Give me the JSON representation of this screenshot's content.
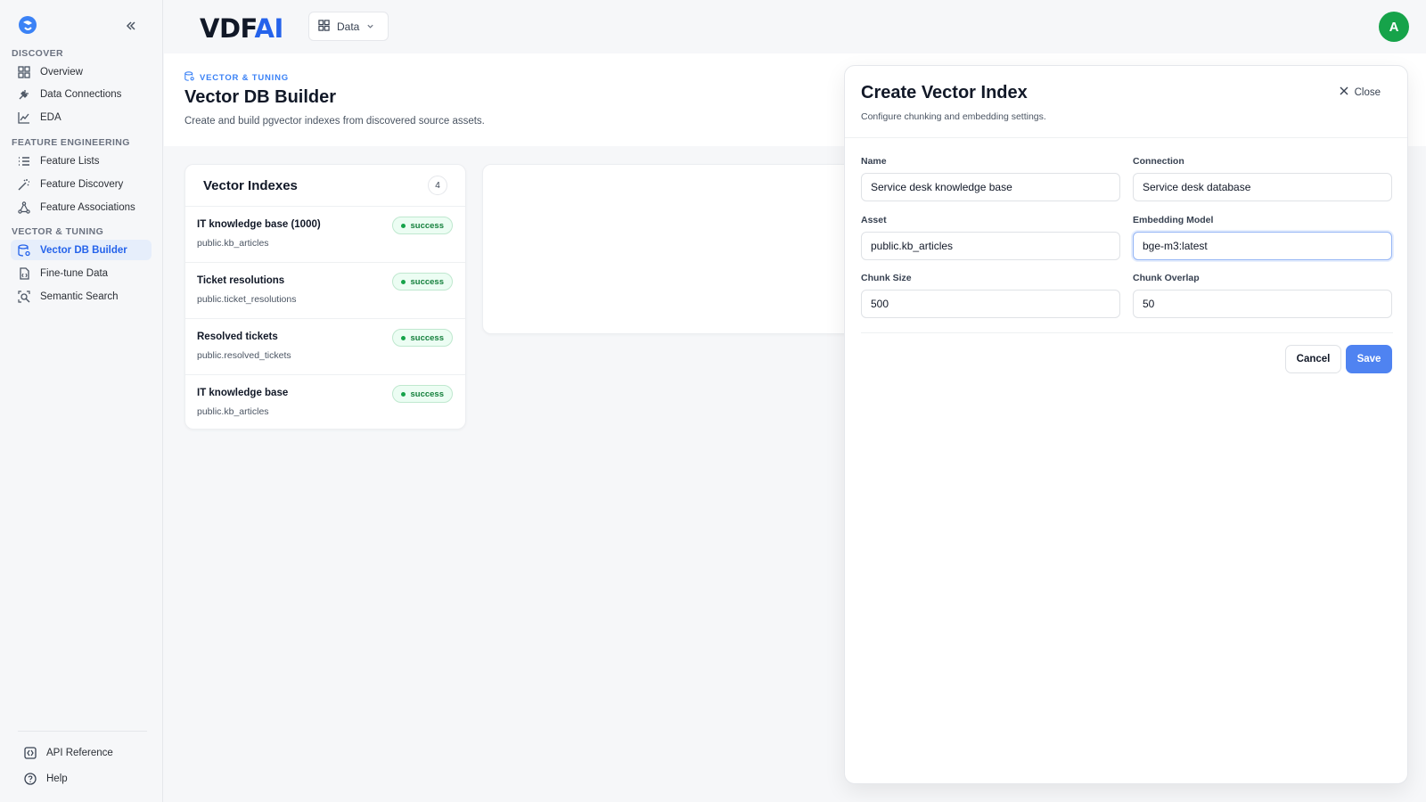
{
  "brand": {
    "name_prefix": "VDF",
    "name_accent": "AI"
  },
  "topbar": {
    "data_dropdown_label": "Data",
    "avatar_initial": "A"
  },
  "sidebar": {
    "sections": [
      {
        "label": "DISCOVER",
        "items": [
          "Overview",
          "Data Connections",
          "EDA"
        ]
      },
      {
        "label": "FEATURE ENGINEERING",
        "items": [
          "Feature Lists",
          "Feature Discovery",
          "Feature Associations"
        ]
      },
      {
        "label": "VECTOR & TUNING",
        "items": [
          "Vector DB Builder",
          "Fine-tune Data",
          "Semantic Search"
        ]
      }
    ],
    "active_item": "Vector DB Builder",
    "bottom": [
      "API Reference",
      "Help"
    ]
  },
  "header": {
    "eyebrow": "VECTOR & TUNING",
    "title": "Vector DB Builder",
    "subtitle": "Create and build pgvector indexes from discovered source assets."
  },
  "indexes": {
    "title": "Vector Indexes",
    "count": "4",
    "rows": [
      {
        "name": "IT knowledge base (1000)",
        "asset": "public.kb_articles",
        "status": "success"
      },
      {
        "name": "Ticket resolutions",
        "asset": "public.ticket_resolutions",
        "status": "success"
      },
      {
        "name": "Resolved tickets",
        "asset": "public.resolved_tickets",
        "status": "success"
      },
      {
        "name": "IT knowledge base",
        "asset": "public.kb_articles",
        "status": "success"
      }
    ]
  },
  "modal": {
    "title": "Create Vector Index",
    "subtitle": "Configure chunking and embedding settings.",
    "close_label": "Close",
    "fields": {
      "name": {
        "label": "Name",
        "value": "Service desk knowledge base"
      },
      "connection": {
        "label": "Connection",
        "value": "Service desk database"
      },
      "asset": {
        "label": "Asset",
        "value": "public.kb_articles"
      },
      "embedding_model": {
        "label": "Embedding Model",
        "value": "bge-m3:latest"
      },
      "chunk_size": {
        "label": "Chunk Size",
        "value": "500"
      },
      "chunk_overlap": {
        "label": "Chunk Overlap",
        "value": "50"
      }
    },
    "cancel_label": "Cancel",
    "save_label": "Save"
  },
  "colors": {
    "accent": "#2563eb",
    "success": "#16a34a",
    "avatar": "#16a34a"
  }
}
